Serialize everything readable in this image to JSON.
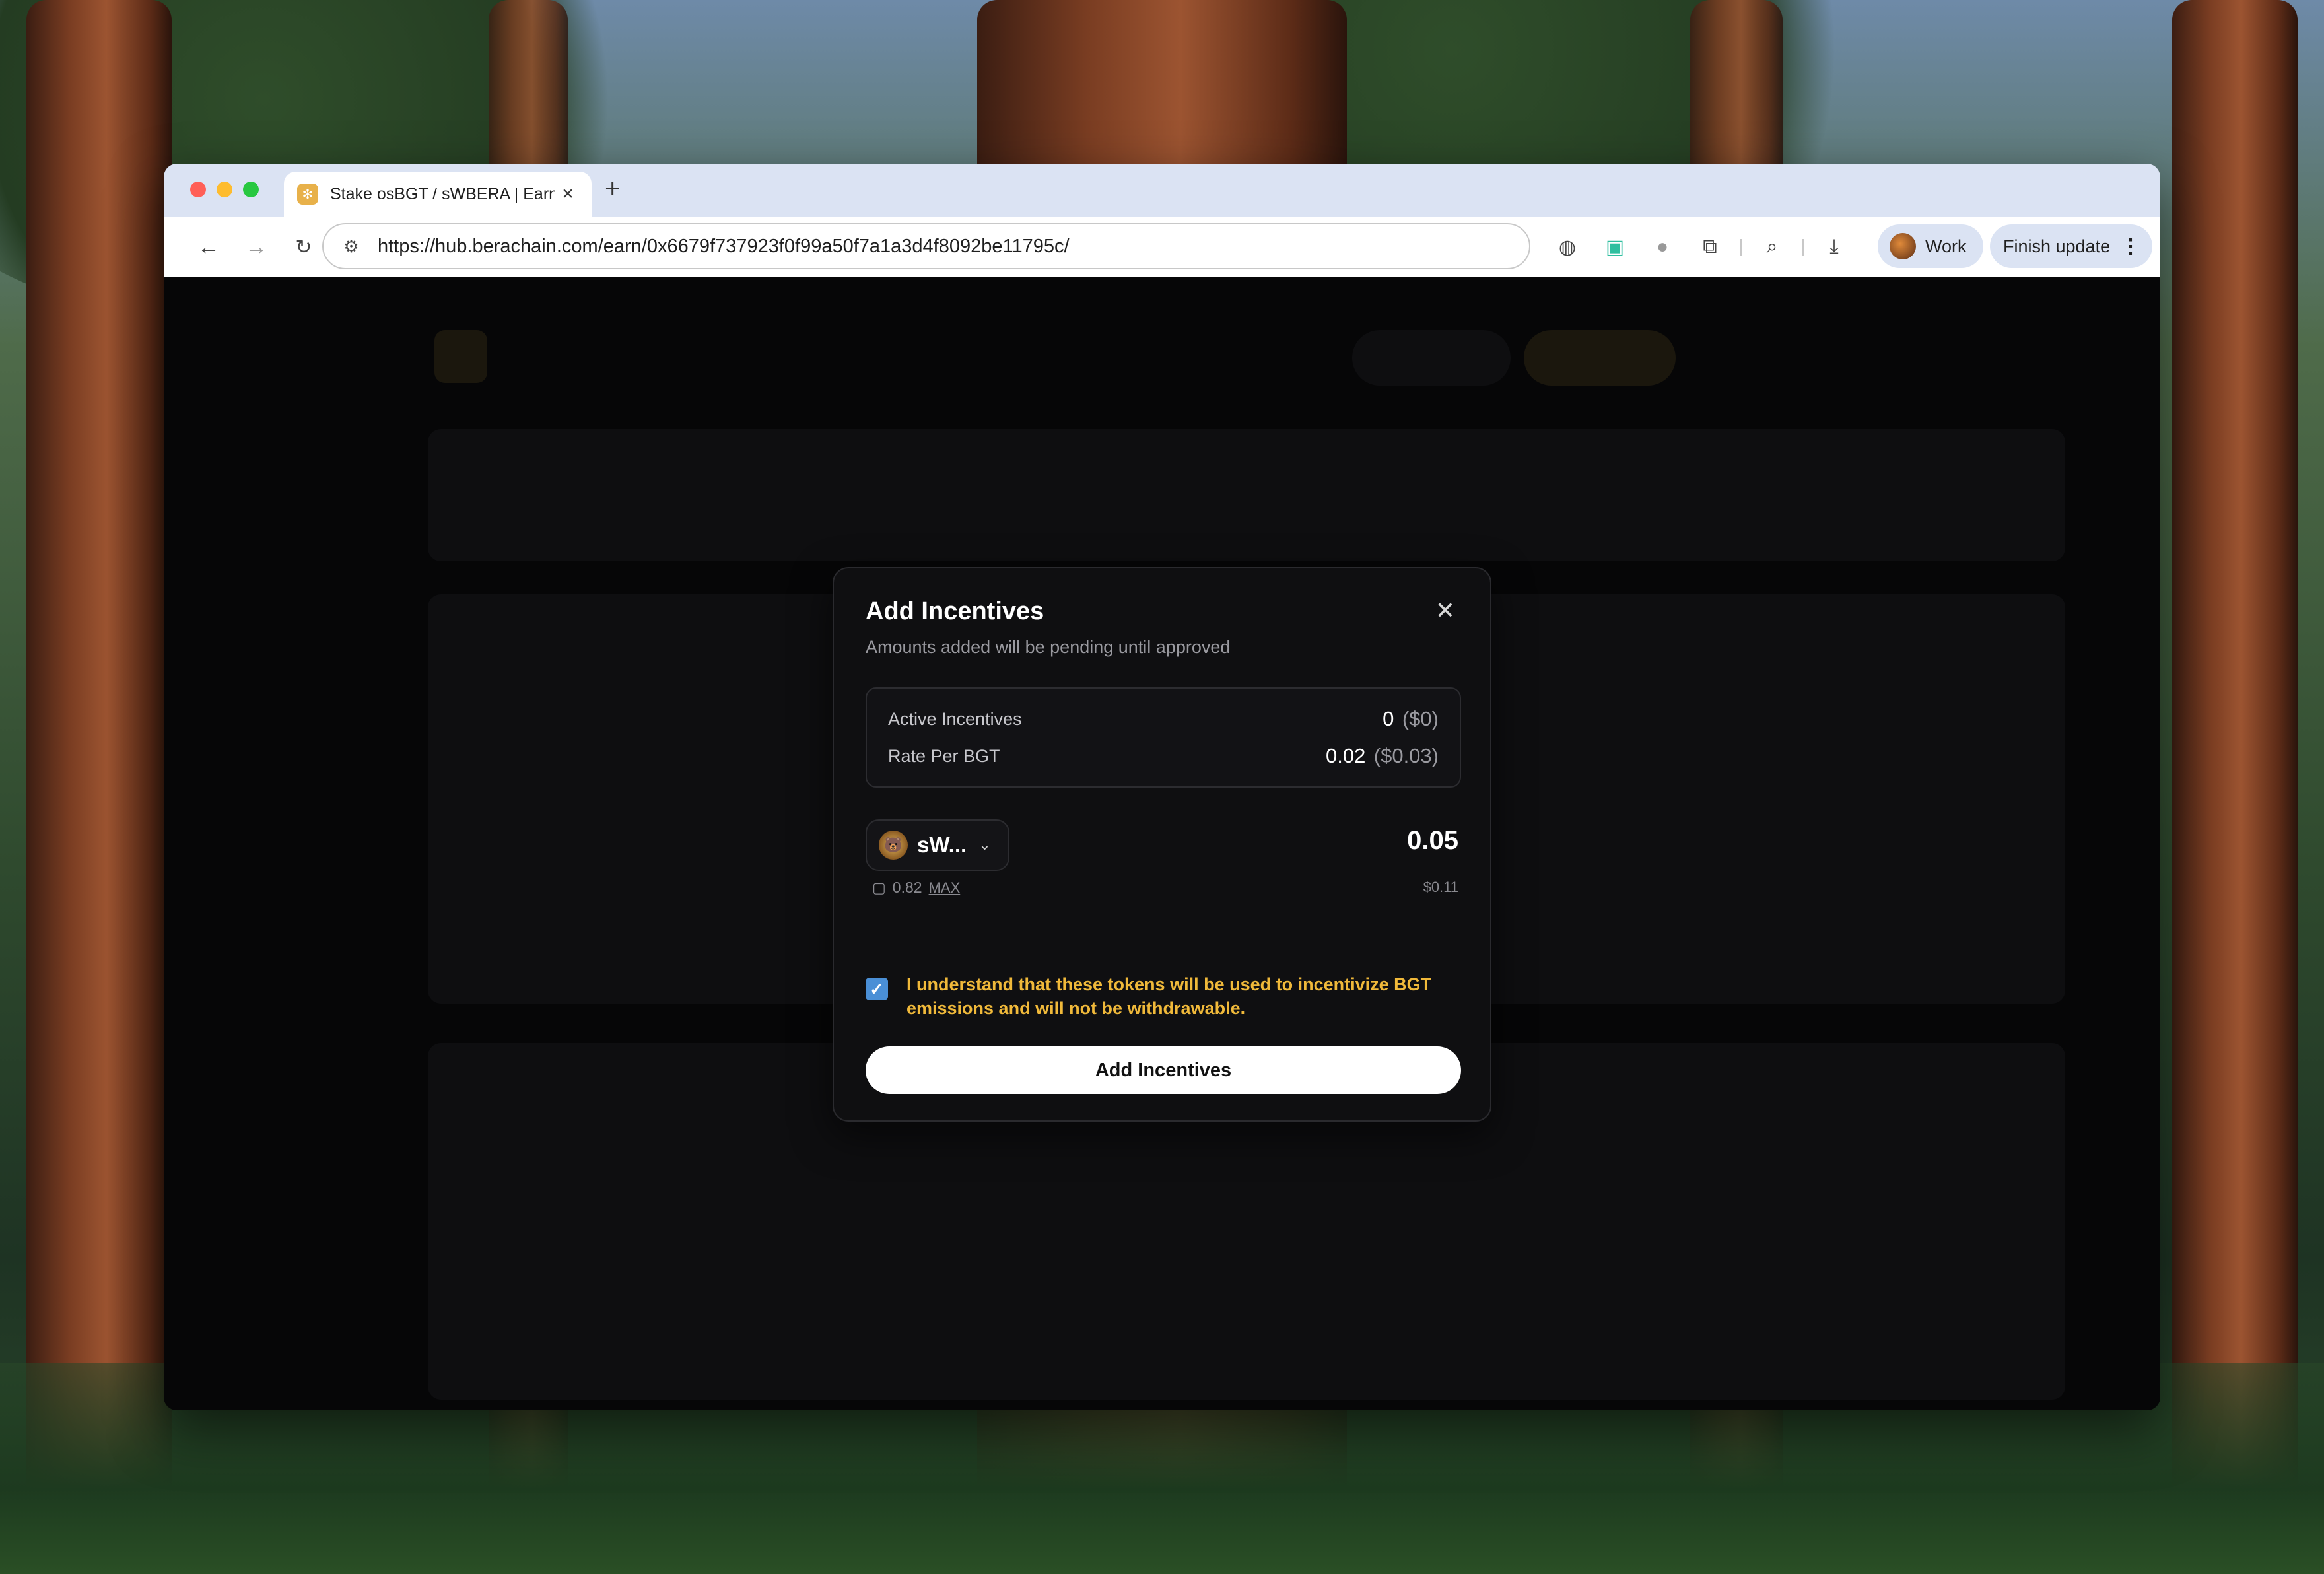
{
  "browser": {
    "tab_title": "Stake osBGT / sWBERA | Earn",
    "url": "https://hub.berachain.com/earn/0x6679f737923f0f99a50f7a1a3d4f8092be11795c/",
    "profile_label": "Work",
    "update_label": "Finish update"
  },
  "modal": {
    "title": "Add Incentives",
    "subtitle": "Amounts added will be pending until approved",
    "active_incentives": {
      "label": "Active Incentives",
      "value": "0",
      "usd": "($0)"
    },
    "rate_per_bgt": {
      "label": "Rate Per BGT",
      "value": "0.02",
      "usd": "($0.03)"
    },
    "token": {
      "symbol": "sW...",
      "balance": "0.82",
      "max_label": "MAX"
    },
    "amount": "0.05",
    "amount_usd": "$0.11",
    "checkbox_checked": true,
    "acknowledgement": "I understand that these tokens will be used to incentivize BGT emissions and will not be withdrawable.",
    "submit_label": "Add Incentives"
  },
  "colors": {
    "accent_warning": "#f0b93a",
    "checkbox": "#4a8fd6",
    "modal_bg": "#0f0f11"
  }
}
